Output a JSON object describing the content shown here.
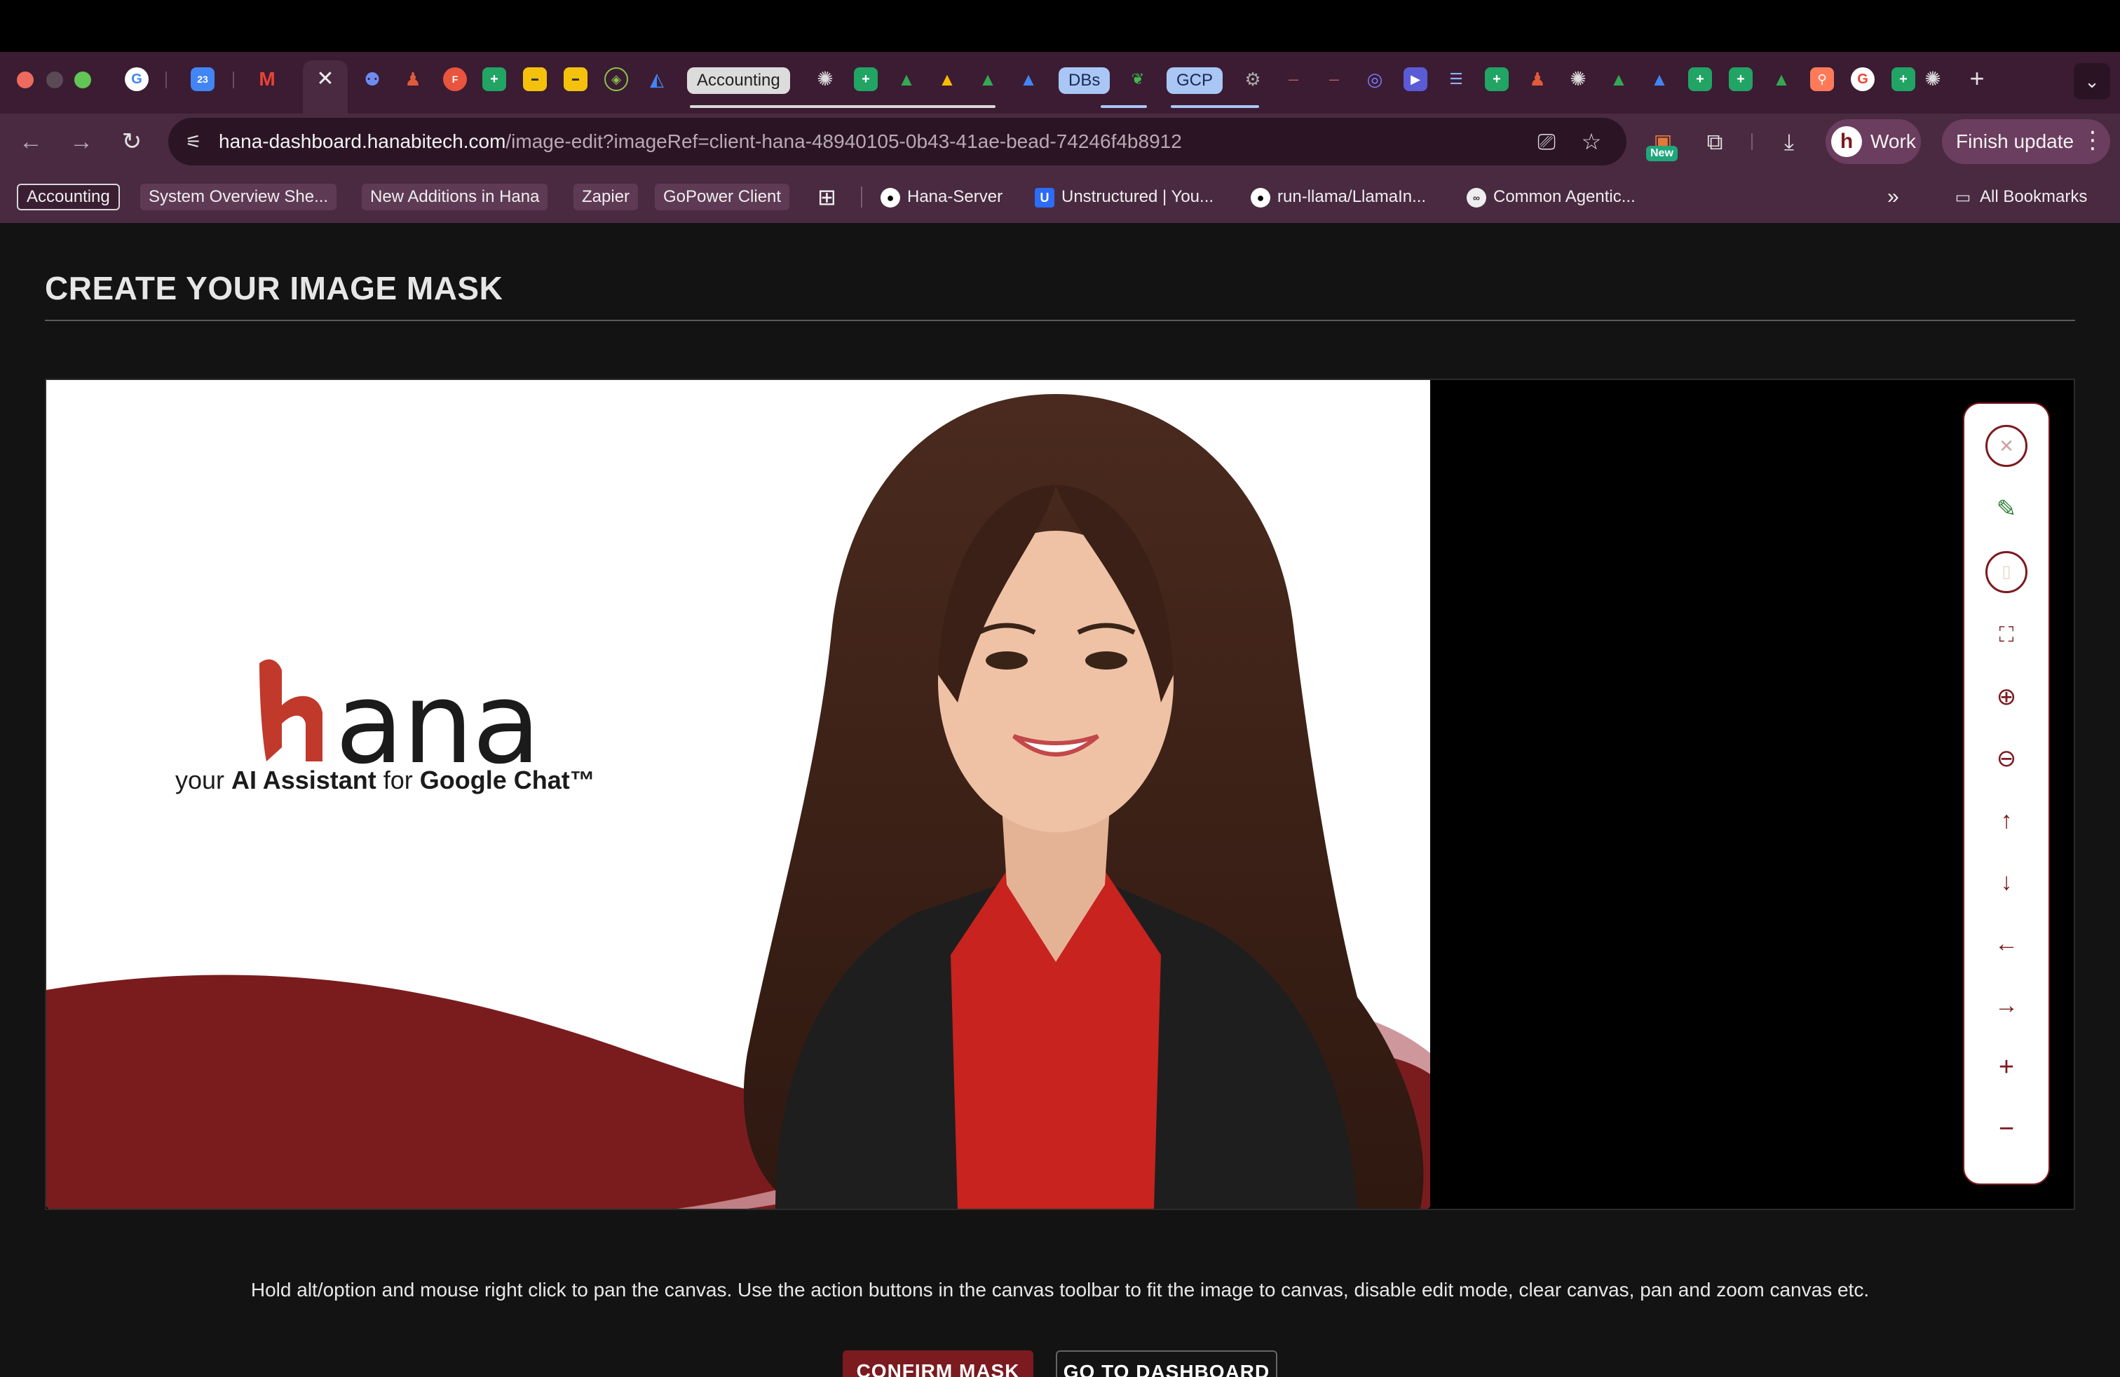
{
  "window": {
    "active_tab_close": "✕",
    "tabs_named": {
      "accounting": "Accounting",
      "dbs": "DBs",
      "gcp": "GCP"
    },
    "new_tab": "+",
    "tab_menu": "⌄"
  },
  "toolbar": {
    "back": "←",
    "forward": "→",
    "reload": "↻",
    "url_host": "hana-dashboard.hanabitech.com",
    "url_path": "/image-edit?imageRef=client-hana-48940105-0b43-41ae-bead-74246f4b8912",
    "new_badge": "New",
    "profile_label": "Work",
    "profile_initial": "h",
    "finish_label": "Finish update",
    "finish_more": "⋮"
  },
  "bookmarks": {
    "items": [
      "Accounting",
      "System Overview She...",
      "New Additions in Hana",
      "Zapier",
      "GoPower Client",
      "Hana-Server",
      "Unstructured | You...",
      "run-llama/LlamaIn...",
      "Common Agentic..."
    ],
    "overflow": "»",
    "all_label": "All Bookmarks"
  },
  "page": {
    "title": "CREATE YOUR IMAGE MASK",
    "hint": "Hold alt/option and mouse right click to pan the canvas. Use the action buttons in the canvas toolbar to fit the image to canvas, disable edit mode, clear canvas, pan and zoom canvas etc.",
    "confirm_label": "CONFIRM MASK",
    "dashboard_label": "GO TO DASHBOARD"
  },
  "image": {
    "brand_word": "ana",
    "tagline_prefix": "your ",
    "tagline_bold1": "AI Assistant",
    "tagline_mid": " for ",
    "tagline_bold2": "Google Chat™"
  },
  "canvas_tools": [
    {
      "name": "close-circle-icon",
      "glyph": "✕"
    },
    {
      "name": "edit-pencil-icon",
      "glyph": "✎"
    },
    {
      "name": "clear-eraser-icon",
      "glyph": "▯"
    },
    {
      "name": "fit-screen-icon",
      "glyph": "⛶"
    },
    {
      "name": "zoom-in-icon",
      "glyph": "⊕"
    },
    {
      "name": "zoom-out-icon",
      "glyph": "⊖"
    },
    {
      "name": "pan-up-icon",
      "glyph": "↑"
    },
    {
      "name": "pan-down-icon",
      "glyph": "↓"
    },
    {
      "name": "pan-left-icon",
      "glyph": "←"
    },
    {
      "name": "pan-right-icon",
      "glyph": "→"
    },
    {
      "name": "brush-plus-icon",
      "glyph": "+"
    },
    {
      "name": "brush-minus-icon",
      "glyph": "−"
    }
  ],
  "colors": {
    "brand_red": "#7b1a1f",
    "tab_bar": "#3b1c33",
    "toolbar": "#4a2a41"
  }
}
